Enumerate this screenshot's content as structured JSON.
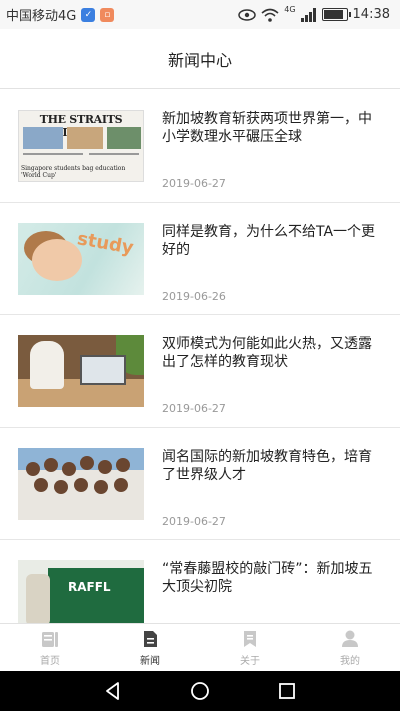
{
  "status_bar": {
    "carrier": "中国移动4G",
    "network": "4G",
    "time": "14:38",
    "battery_level": 0.9
  },
  "header": {
    "title": "新闻中心"
  },
  "news": [
    {
      "title": "新加坡教育斩获两项世界第一，中小学数理水平碾压全球",
      "date": "2019-06-27",
      "thumb_text": "THE STRAITS TIMES",
      "thumb_caption": "Singapore students bag education 'World Cup'"
    },
    {
      "title": "同样是教育，为什么不给TA一个更好的",
      "date": "2019-06-26",
      "thumb_text": "study"
    },
    {
      "title": "双师模式为何能如此火热，又透露出了怎样的教育现状",
      "date": "2019-06-27"
    },
    {
      "title": "闻名国际的新加坡教育特色，培育了世界级人才",
      "date": "2019-06-27"
    },
    {
      "title": "“常春藤盟校的敲门砖”：新加坡五大顶尖初院",
      "date": "",
      "thumb_text": "RAFFL"
    }
  ],
  "tabs": [
    {
      "label": "首页",
      "icon": "home-icon",
      "active": false
    },
    {
      "label": "新闻",
      "icon": "news-icon",
      "active": true
    },
    {
      "label": "关于",
      "icon": "bookmark-icon",
      "active": false
    },
    {
      "label": "我的",
      "icon": "user-icon",
      "active": false
    }
  ],
  "colors": {
    "tab_inactive": "#aaaaaa",
    "tab_active": "#333333",
    "date": "#999999"
  }
}
